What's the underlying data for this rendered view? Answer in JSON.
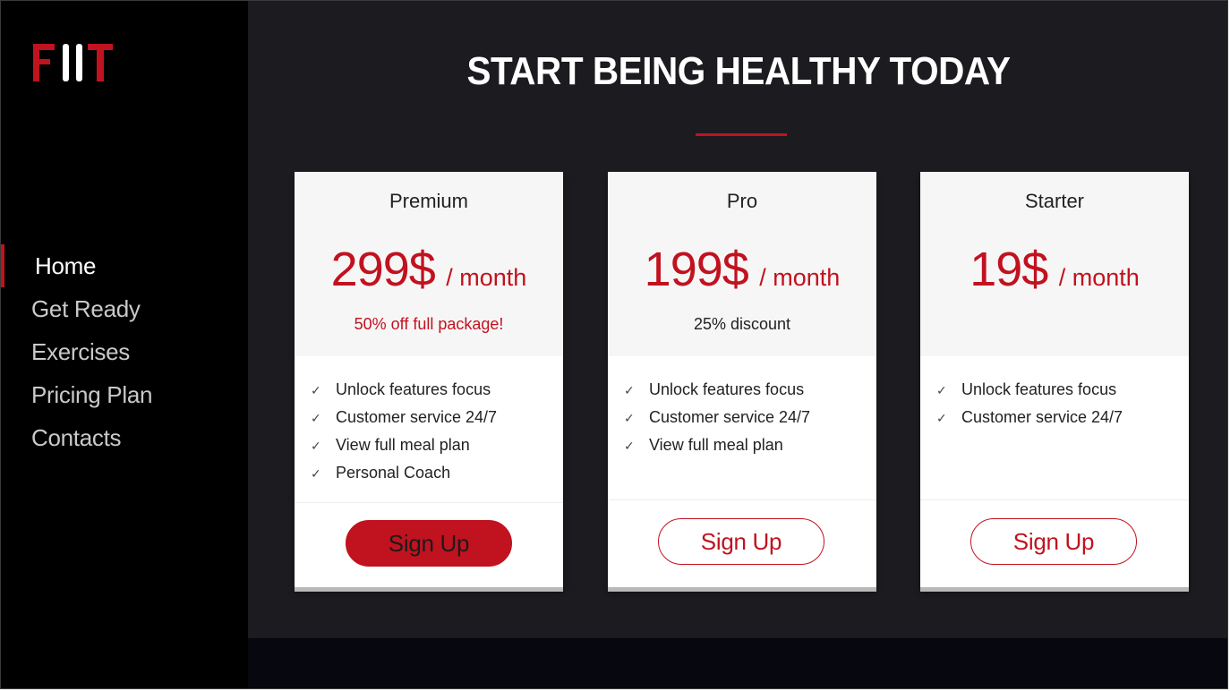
{
  "brand": {
    "logo_text": "FIIT",
    "accent": "#c1121f"
  },
  "sidebar": {
    "items": [
      {
        "label": "Home",
        "active": true
      },
      {
        "label": "Get Ready",
        "active": false
      },
      {
        "label": "Exercises",
        "active": false
      },
      {
        "label": "Pricing Plan",
        "active": false
      },
      {
        "label": "Contacts",
        "active": false
      }
    ]
  },
  "main": {
    "headline": "START BEING HEALTHY TODAY",
    "plans": [
      {
        "name": "Premium",
        "price": "299$",
        "period": "/ month",
        "promo": "50% off full package!",
        "promo_color": "#c1121f",
        "features": [
          "Unlock features focus",
          "Customer service 24/7",
          "View full meal plan",
          "Personal Coach"
        ],
        "button_label": "Sign Up",
        "button_style": "filled"
      },
      {
        "name": "Pro",
        "price": "199$",
        "period": "/ month",
        "promo": "25% discount",
        "promo_color": "#222222",
        "features": [
          "Unlock features focus",
          "Customer service 24/7",
          "View full meal plan"
        ],
        "button_label": "Sign Up",
        "button_style": "outline"
      },
      {
        "name": "Starter",
        "price": "19$",
        "period": "/ month",
        "promo": "",
        "features": [
          "Unlock features focus",
          "Customer service 24/7"
        ],
        "button_label": "Sign Up",
        "button_style": "outline"
      }
    ]
  }
}
